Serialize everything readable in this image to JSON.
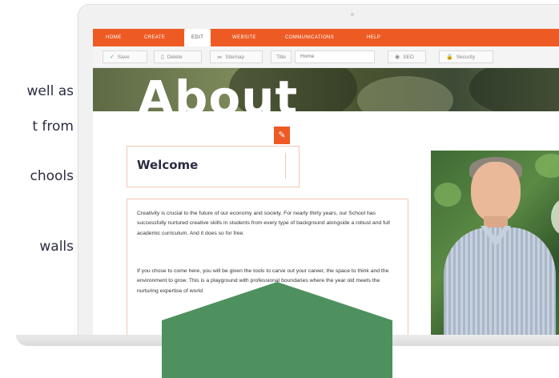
{
  "left_text": {
    "lines": [
      "well as",
      "t from",
      "chools",
      "walls"
    ]
  },
  "menu": {
    "items": [
      "HOME",
      "CREATE",
      "EDIT",
      "WEBSITE",
      "COMMUNICATIONS",
      "HELP"
    ],
    "active": "EDIT"
  },
  "toolbar": {
    "save_label": "Save",
    "delete_label": "Delete",
    "sitemap_label": "Sitemap",
    "title_label": "Title",
    "title_value": "Home",
    "seo_label": "SEO",
    "security_label": "Security"
  },
  "hero": {
    "title": "About"
  },
  "welcome": {
    "heading": "Welcome"
  },
  "body": {
    "paragraph_1": "Creativity is crucial to the future of our economy and society. For nearly thirty years, our School has successfully nurtured creative skills in students from every type of background alongside a robust and full academic curriculum. And it does so for free.",
    "paragraph_2": "If you chose to come here, you will be given the tools to carve out your career, the space to think and the environment to grow. This is a playground with professional boundaries where the year old meets the nurturing expertise of world"
  },
  "colors": {
    "accent": "#ee5a24",
    "green_shape": "#4e915e",
    "text_dark": "#2b2d42"
  },
  "icons": {
    "save": "check-icon",
    "delete": "trash-icon",
    "sitemap": "sitemap-icon",
    "seo": "eye-icon",
    "security": "lock-icon",
    "edit": "pencil-icon"
  }
}
